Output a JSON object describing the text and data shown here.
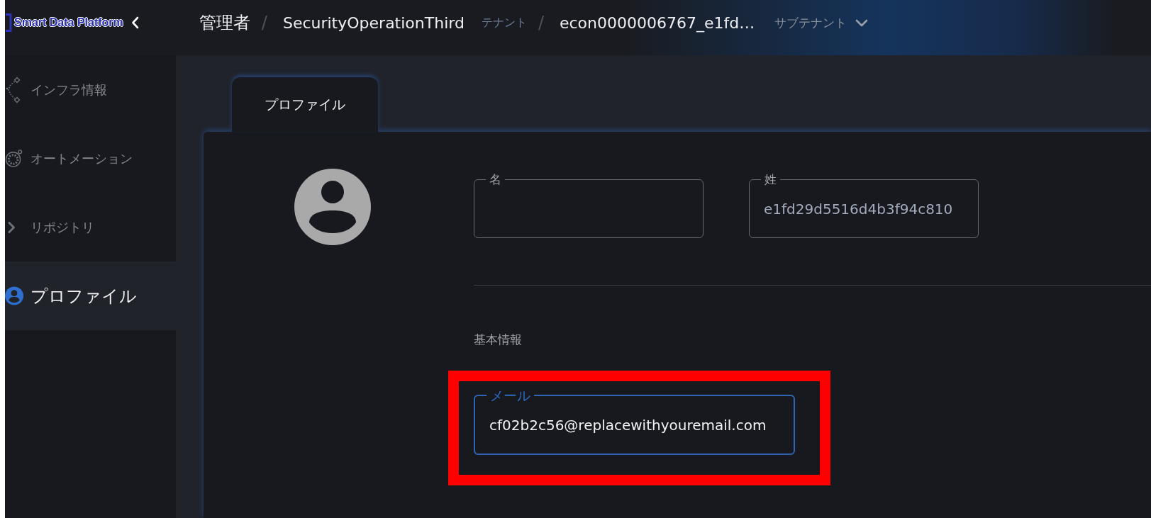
{
  "header": {
    "logo": "Smart Data Platform",
    "breadcrumb": [
      {
        "label": "管理者",
        "dropdown": false
      },
      {
        "separator": "/",
        "label": "SecurityOperationThird",
        "caption": "テナント",
        "dropdown": false
      },
      {
        "separator": "/",
        "label": "econ0000006767_e1fd…",
        "caption": "サブテナント",
        "dropdown": true
      }
    ]
  },
  "sidebar": {
    "items": [
      {
        "label": "インフラ情報",
        "selected": false
      },
      {
        "label": "オートメーション",
        "selected": false
      },
      {
        "label": "リポジトリ",
        "selected": false
      },
      {
        "label": "プロファイル",
        "selected": true
      }
    ]
  },
  "tabs": [
    {
      "label": "プロファイル",
      "selected": true
    }
  ],
  "profile": {
    "name_fields": [
      {
        "label": "名",
        "focused": false
      },
      {
        "label": "姓",
        "value": "e1fd29d5516d4b3f94c810",
        "focused": false
      }
    ],
    "basic_info": {
      "title": "基本情報",
      "fields": [
        {
          "label": "メール",
          "value": "cf02b2c56@replacewithyouremail.com",
          "focused": true,
          "highlighted": true
        }
      ]
    }
  }
}
